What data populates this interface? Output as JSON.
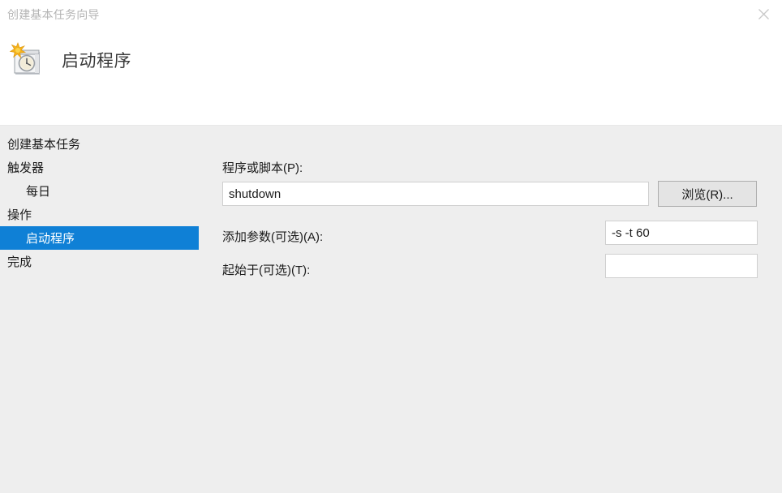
{
  "window": {
    "title": "创建基本任务向导",
    "close_label": "×",
    "close_icon": "close-icon"
  },
  "page": {
    "icon": "task-scheduler-clock-calendar-icon",
    "heading": "启动程序"
  },
  "sidebar": {
    "items": [
      {
        "label": "创建基本任务",
        "indent": false,
        "selected": false
      },
      {
        "label": "触发器",
        "indent": false,
        "selected": false
      },
      {
        "label": "每日",
        "indent": true,
        "selected": false
      },
      {
        "label": "操作",
        "indent": false,
        "selected": false
      },
      {
        "label": "启动程序",
        "indent": true,
        "selected": true
      },
      {
        "label": "完成",
        "indent": false,
        "selected": false
      }
    ]
  },
  "form": {
    "program": {
      "label": "程序或脚本(P):",
      "value": "shutdown",
      "placeholder": ""
    },
    "browse_button": {
      "label": "浏览(R)..."
    },
    "arguments": {
      "label": "添加参数(可选)(A):",
      "value": "-s -t 60",
      "placeholder": ""
    },
    "start_in": {
      "label": "起始于(可选)(T):",
      "value": "",
      "placeholder": ""
    }
  },
  "colors": {
    "accent": "#0f80d6",
    "window_background": "#eeeeee",
    "header_background": "#ffffff",
    "input_background": "#ffffff",
    "title_text": "#b4b4b4",
    "body_text": "#1a1a1a"
  }
}
